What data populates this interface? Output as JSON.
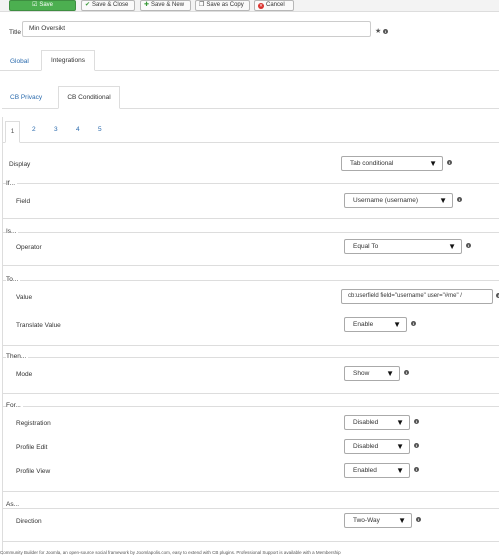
{
  "toolbar": {
    "save": "Save",
    "save_close": "Save & Close",
    "save_new": "Save & New",
    "save_copy": "Save as Copy",
    "cancel": "Cancel"
  },
  "title_field": {
    "label": "Title",
    "value": "Min Oversikt"
  },
  "main_tabs": [
    "Global",
    "Integrations"
  ],
  "sub_tabs": [
    "CB Privacy",
    "CB Conditional"
  ],
  "number_tabs": [
    "1",
    "2",
    "3",
    "4",
    "5"
  ],
  "display": {
    "label": "Display",
    "value": "Tab conditional"
  },
  "if_section": {
    "legend": "If...",
    "field_label": "Field",
    "field_value": "Username (username)"
  },
  "is_section": {
    "legend": "Is...",
    "operator_label": "Operator",
    "operator_value": "Equal To"
  },
  "to_section": {
    "legend": "To...",
    "value_label": "Value",
    "value_text": "cb:userfield field=\"username\" user=\"#me\" /",
    "translate_label": "Translate Value",
    "translate_value": "Enable"
  },
  "then_section": {
    "legend": "Then...",
    "mode_label": "Mode",
    "mode_value": "Show"
  },
  "for_section": {
    "legend": "For...",
    "registration_label": "Registration",
    "registration_value": "Disabled",
    "profile_edit_label": "Profile Edit",
    "profile_edit_value": "Disabled",
    "profile_view_label": "Profile View",
    "profile_view_value": "Enabled"
  },
  "as_section": {
    "legend": "As...",
    "direction_label": "Direction",
    "direction_value": "Two-Way"
  },
  "footer": "Community Builder for Joomla, an open-source social framework by Joomlapolis.com, easy to extend with CB plugins. Professional Support is available with a Membership",
  "colors": {
    "save_green": "#4caf50",
    "link_blue": "#2a6aad",
    "cancel_red": "#d9302c"
  }
}
